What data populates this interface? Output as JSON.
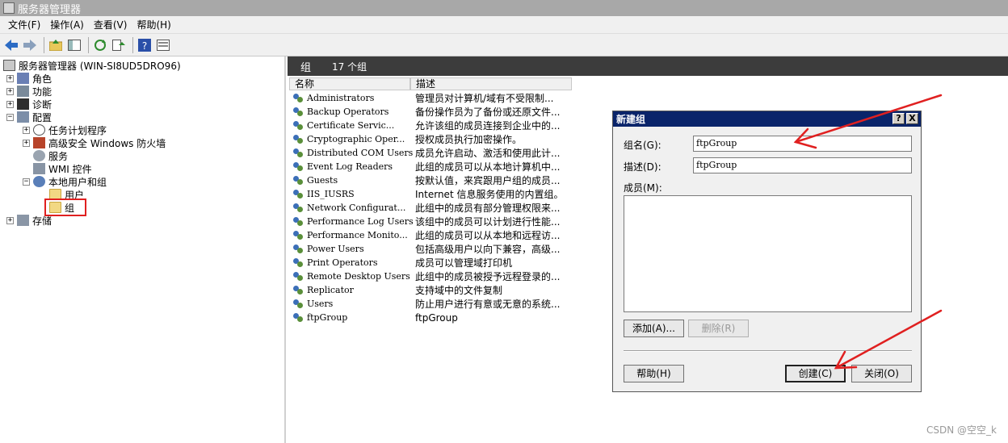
{
  "window": {
    "title": "服务器管理器"
  },
  "menu": [
    "文件(F)",
    "操作(A)",
    "查看(V)",
    "帮助(H)"
  ],
  "tree": {
    "root": "服务器管理器 (WIN-SI8UD5DRO96)",
    "items": [
      {
        "label": "角色",
        "expander": "+"
      },
      {
        "label": "功能",
        "expander": "+"
      },
      {
        "label": "诊断",
        "expander": "+"
      },
      {
        "label": "配置",
        "expander": "−"
      },
      {
        "label": "任务计划程序",
        "expander": "+"
      },
      {
        "label": "高级安全 Windows 防火墙",
        "expander": "+"
      },
      {
        "label": "服务",
        "expander": ""
      },
      {
        "label": "WMI 控件",
        "expander": ""
      },
      {
        "label": "本地用户和组",
        "expander": "−"
      },
      {
        "label": "用户",
        "expander": ""
      },
      {
        "label": "组",
        "expander": ""
      },
      {
        "label": "存储",
        "expander": "+"
      }
    ]
  },
  "panel": {
    "title": "组",
    "count": "17 个组",
    "columns": [
      "名称",
      "描述"
    ],
    "rows": [
      {
        "name": "Administrators",
        "desc": "管理员对计算机/域有不受限制..."
      },
      {
        "name": "Backup Operators",
        "desc": "备份操作员为了备份或还原文件..."
      },
      {
        "name": "Certificate Servic...",
        "desc": "允许该组的成员连接到企业中的..."
      },
      {
        "name": "Cryptographic Oper...",
        "desc": "授权成员执行加密操作。"
      },
      {
        "name": "Distributed COM Users",
        "desc": "成员允许启动、激活和使用此计..."
      },
      {
        "name": "Event Log Readers",
        "desc": "此组的成员可以从本地计算机中..."
      },
      {
        "name": "Guests",
        "desc": "按默认值，来宾跟用户组的成员..."
      },
      {
        "name": "IIS_IUSRS",
        "desc": "Internet 信息服务使用的内置组。"
      },
      {
        "name": "Network Configurat...",
        "desc": "此组中的成员有部分管理权限来..."
      },
      {
        "name": "Performance Log Users",
        "desc": "该组中的成员可以计划进行性能..."
      },
      {
        "name": "Performance Monito...",
        "desc": "此组的成员可以从本地和远程访..."
      },
      {
        "name": "Power Users",
        "desc": "包括高级用户以向下兼容，高级..."
      },
      {
        "name": "Print Operators",
        "desc": "成员可以管理域打印机"
      },
      {
        "name": "Remote Desktop Users",
        "desc": "此组中的成员被授予远程登录的..."
      },
      {
        "name": "Replicator",
        "desc": "支持域中的文件复制"
      },
      {
        "name": "Users",
        "desc": "防止用户进行有意或无意的系统..."
      },
      {
        "name": "ftpGroup",
        "desc": "ftpGroup"
      }
    ]
  },
  "dialog": {
    "title": "新建组",
    "help_glyph": "?",
    "close_glyph": "X",
    "name_label": "组名(G):",
    "name_value": "ftpGroup",
    "desc_label": "描述(D):",
    "desc_value": "ftpGroup",
    "members_label": "成员(M):",
    "add_label": "添加(A)...",
    "remove_label": "删除(R)",
    "help_label": "帮助(H)",
    "create_label": "创建(C)",
    "close_label": "关闭(O)"
  },
  "watermark": "CSDN @空空_k",
  "colors": {
    "annotation": "#e02020",
    "dialog_title": "#0a246a",
    "panel_header": "#3c3c3c"
  }
}
